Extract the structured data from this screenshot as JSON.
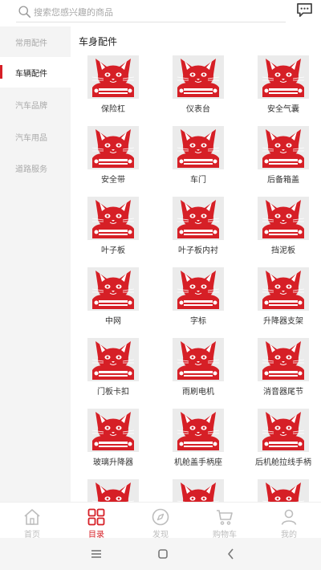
{
  "search": {
    "placeholder": "搜索您感兴趣的商品"
  },
  "sidebar": {
    "items": [
      {
        "label": "常用配件",
        "active": false
      },
      {
        "label": "车辆配件",
        "active": true
      },
      {
        "label": "汽车品牌",
        "active": false
      },
      {
        "label": "汽车用品",
        "active": false
      },
      {
        "label": "道路服务",
        "active": false
      }
    ]
  },
  "content": {
    "section_title": "车身配件",
    "items": [
      {
        "label": "保险杠"
      },
      {
        "label": "仪表台"
      },
      {
        "label": "安全气囊"
      },
      {
        "label": "安全带"
      },
      {
        "label": "车门"
      },
      {
        "label": "后备箱盖"
      },
      {
        "label": "叶子板"
      },
      {
        "label": "叶子板内衬"
      },
      {
        "label": "挡泥板"
      },
      {
        "label": "中网"
      },
      {
        "label": "字标"
      },
      {
        "label": "升降器支架"
      },
      {
        "label": "门板卡扣"
      },
      {
        "label": "雨刷电机"
      },
      {
        "label": "消音器尾节"
      },
      {
        "label": "玻璃升降器"
      },
      {
        "label": "机舱盖手柄座"
      },
      {
        "label": "后机舱拉线手柄"
      },
      {
        "label": ""
      },
      {
        "label": ""
      },
      {
        "label": ""
      }
    ],
    "item_icon": "red-cat-car-placeholder-icon"
  },
  "tabbar": {
    "tabs": [
      {
        "label": "首页",
        "icon": "home-icon",
        "active": false
      },
      {
        "label": "目录",
        "icon": "grid-icon",
        "active": true
      },
      {
        "label": "发现",
        "icon": "compass-icon",
        "active": false
      },
      {
        "label": "购物车",
        "icon": "cart-icon",
        "active": false
      },
      {
        "label": "我的",
        "icon": "user-icon",
        "active": false
      }
    ]
  },
  "colors": {
    "accent": "#d61f26",
    "inactive": "#bdbdbd",
    "sidebar_bg": "#f4f4f4"
  }
}
